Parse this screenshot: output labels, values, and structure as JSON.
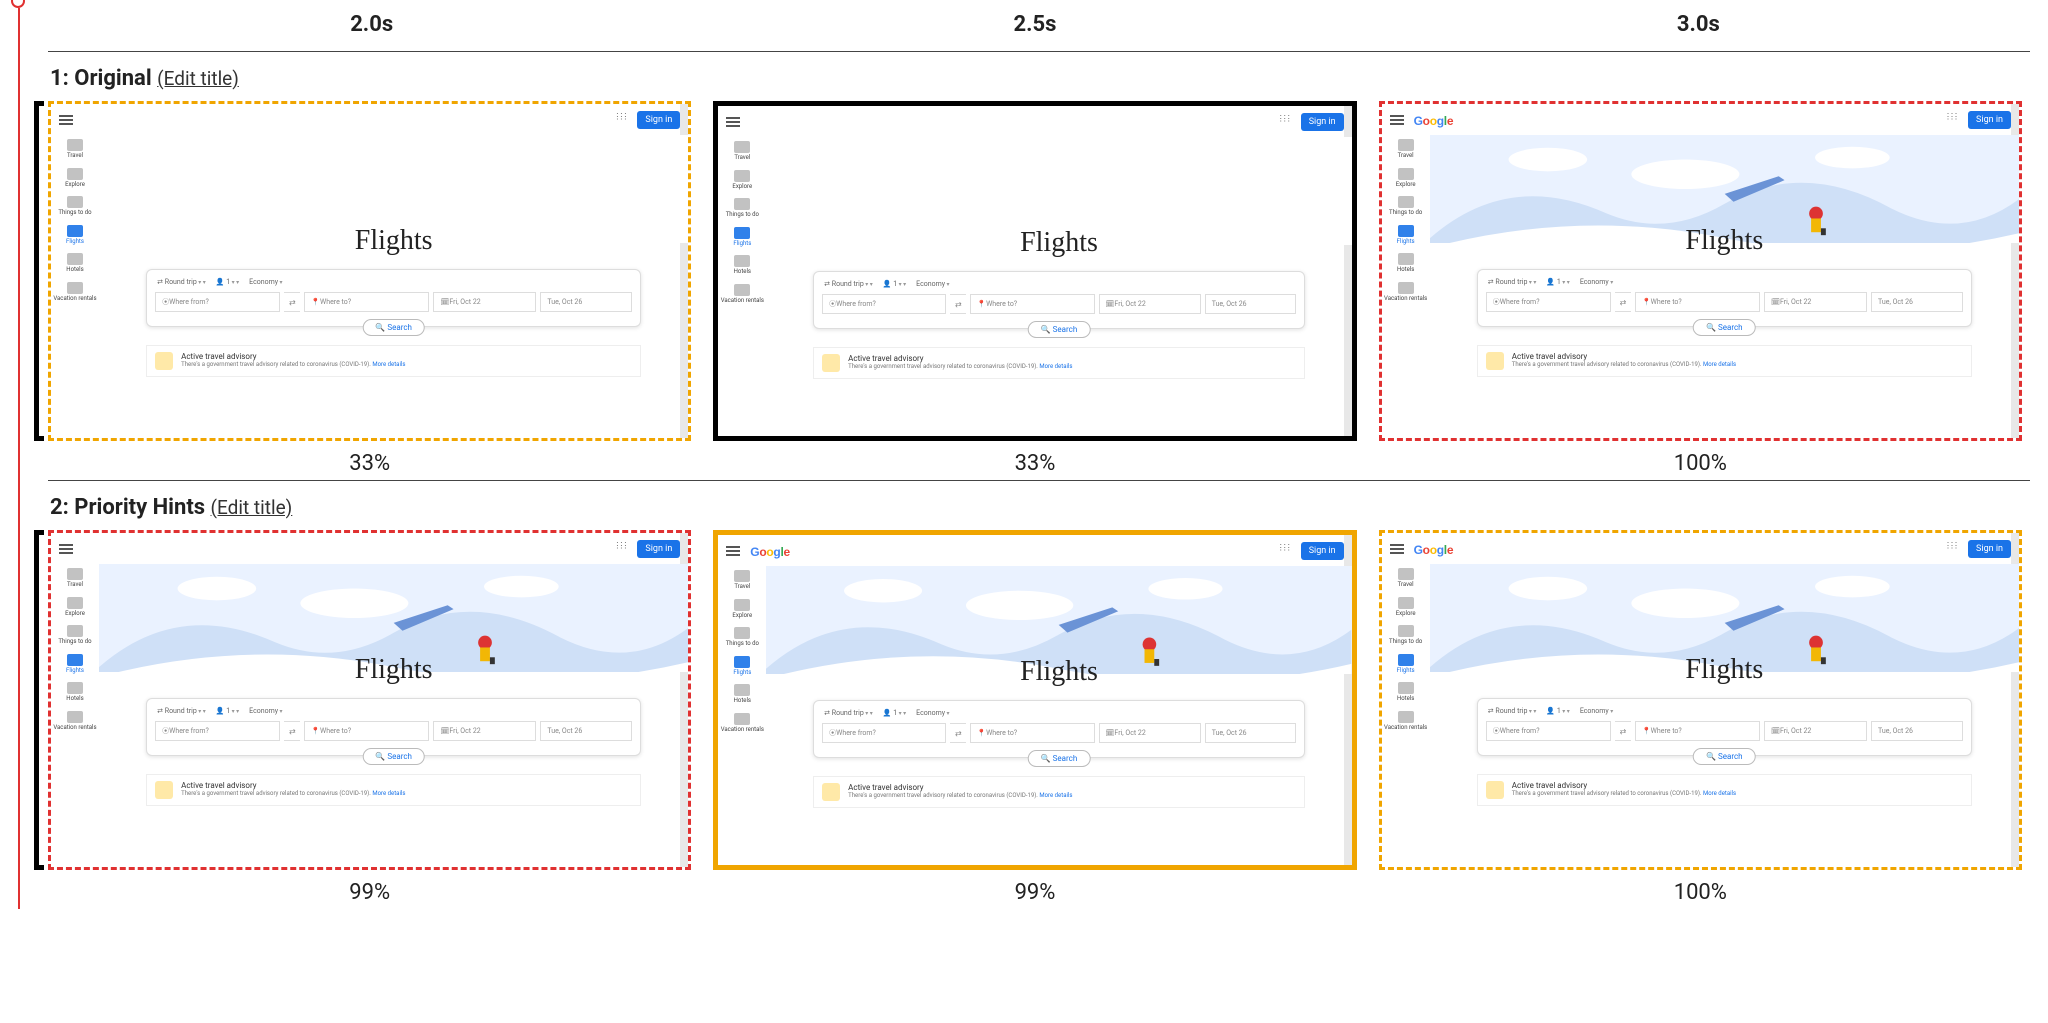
{
  "time_columns": [
    "2.0s",
    "2.5s",
    "3.0s"
  ],
  "edit_title_label": "(Edit title)",
  "rows": [
    {
      "idx": "1",
      "name": "Original",
      "frames": [
        {
          "pct": "33%",
          "border": "bd-amber",
          "hero_loaded": false,
          "show_logo": false,
          "lcp_bracket": true
        },
        {
          "pct": "33%",
          "border": "bd-black",
          "hero_loaded": false,
          "show_logo": false,
          "lcp_bracket": false
        },
        {
          "pct": "100%",
          "border": "bd-red",
          "hero_loaded": true,
          "show_logo": true,
          "lcp_bracket": false
        }
      ]
    },
    {
      "idx": "2",
      "name": "Priority Hints",
      "frames": [
        {
          "pct": "99%",
          "border": "bd-red",
          "hero_loaded": true,
          "show_logo": false,
          "lcp_bracket": true
        },
        {
          "pct": "99%",
          "border": "bd-amber-solid",
          "hero_loaded": true,
          "show_logo": true,
          "lcp_bracket": false
        },
        {
          "pct": "100%",
          "border": "bd-amber",
          "hero_loaded": true,
          "show_logo": true,
          "lcp_bracket": false
        }
      ]
    }
  ],
  "mini": {
    "signin": "Sign in",
    "hero_title": "Flights",
    "sidebar": [
      {
        "label": "Travel"
      },
      {
        "label": "Explore"
      },
      {
        "label": "Things to do"
      },
      {
        "label": "Flights",
        "active": true
      },
      {
        "label": "Hotels"
      },
      {
        "label": "Vacation rentals"
      }
    ],
    "chips": {
      "trip": "Round trip",
      "pax": "1",
      "cabin": "Economy"
    },
    "fields": {
      "from_ph": "Where from?",
      "to_ph": "Where to?",
      "date1": "Fri, Oct 22",
      "date2": "Tue, Oct 26"
    },
    "search_btn": "Search",
    "advisory": {
      "title": "Active travel advisory",
      "detail_pre": "There's a government travel advisory related to coronavirus (COVID-19). ",
      "detail_link": "More details"
    }
  }
}
